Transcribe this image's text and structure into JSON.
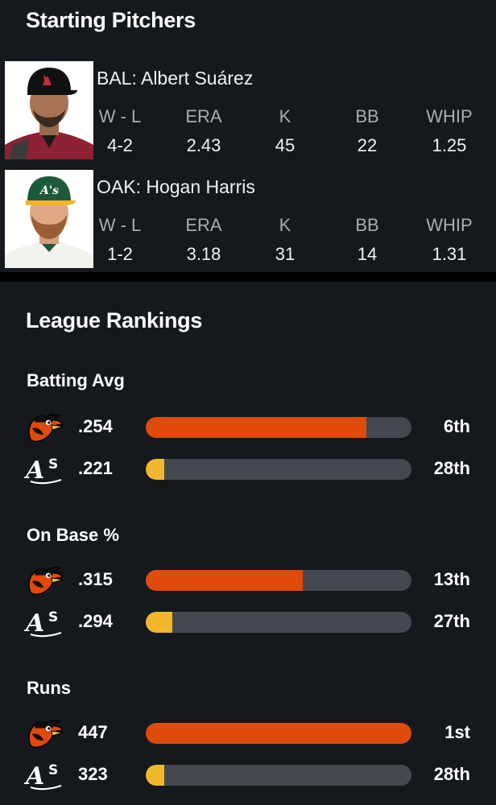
{
  "starting_pitchers": {
    "title": "Starting Pitchers",
    "stat_headers": [
      "W - L",
      "ERA",
      "K",
      "BB",
      "WHIP"
    ],
    "pitchers": [
      {
        "name": "BAL: Albert Suárez",
        "stats": [
          "4-2",
          "2.43",
          "45",
          "22",
          "1.25"
        ],
        "avatar_icon": "player-headshot-diamondbacks-cap"
      },
      {
        "name": "OAK: Hogan Harris",
        "stats": [
          "1-2",
          "3.18",
          "31",
          "14",
          "1.31"
        ],
        "avatar_icon": "player-headshot-athletics-cap"
      }
    ]
  },
  "league_rankings": {
    "title": "League Rankings",
    "categories": [
      {
        "title": "Batting Avg",
        "rows": [
          {
            "team_icon": "orioles-logo-icon",
            "value": ".254",
            "rank": "6th",
            "bar_fill": 0.83,
            "color": "#e04a0d"
          },
          {
            "team_icon": "athletics-logo-icon",
            "value": ".221",
            "rank": "28th",
            "bar_fill": 0.07,
            "color": "#f2b82b"
          }
        ]
      },
      {
        "title": "On Base %",
        "rows": [
          {
            "team_icon": "orioles-logo-icon",
            "value": ".315",
            "rank": "13th",
            "bar_fill": 0.59,
            "color": "#e04a0d"
          },
          {
            "team_icon": "athletics-logo-icon",
            "value": ".294",
            "rank": "27th",
            "bar_fill": 0.1,
            "color": "#f2b82b"
          }
        ]
      },
      {
        "title": "Runs",
        "rows": [
          {
            "team_icon": "orioles-logo-icon",
            "value": "447",
            "rank": "1st",
            "bar_fill": 1.0,
            "color": "#e04a0d"
          },
          {
            "team_icon": "athletics-logo-icon",
            "value": "323",
            "rank": "28th",
            "bar_fill": 0.07,
            "color": "#f2b82b"
          }
        ]
      }
    ]
  }
}
